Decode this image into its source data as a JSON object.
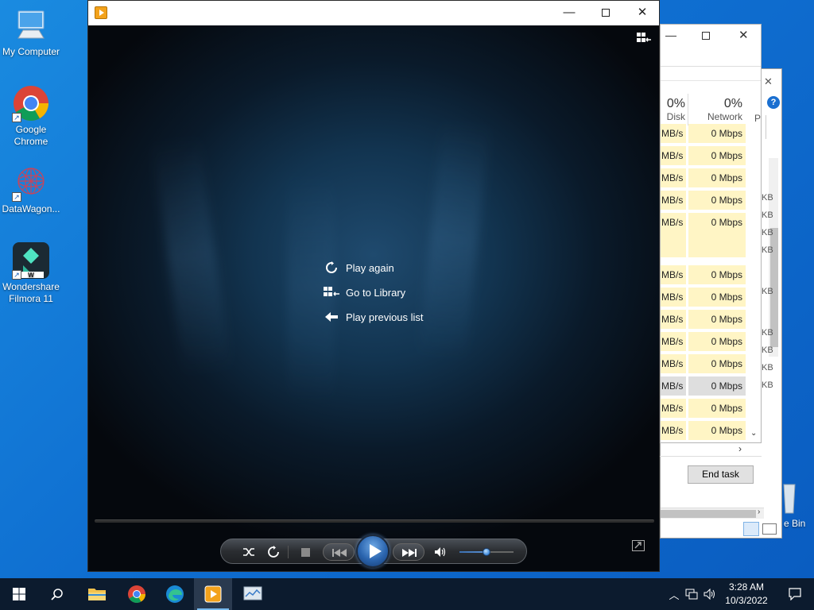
{
  "desktop": {
    "icons": [
      {
        "label": "My Computer"
      },
      {
        "label": "Google Chrome"
      },
      {
        "label": "DataWagon..."
      },
      {
        "label": "Wondershare Filmora 11"
      }
    ],
    "recycle_bin_label_partial": "e Bin"
  },
  "media_player": {
    "title": "",
    "menu": [
      {
        "label": "Play again",
        "icon": "replay-icon"
      },
      {
        "label": "Go to Library",
        "icon": "library-icon"
      },
      {
        "label": "Play previous list",
        "icon": "back-arrow-icon"
      }
    ],
    "controls": [
      "shuffle",
      "repeat",
      "stop",
      "previous",
      "play",
      "next",
      "mute",
      "volume"
    ],
    "volume_fraction": 0.5
  },
  "task_manager": {
    "disk_header": {
      "pct": "0%",
      "label": "Disk"
    },
    "network_header": {
      "pct": "0%",
      "label": "Network"
    },
    "partial_col": "P",
    "rows": [
      {
        "disk": "MB/s",
        "net": "0 Mbps"
      },
      {
        "disk": "MB/s",
        "net": "0 Mbps"
      },
      {
        "disk": "MB/s",
        "net": "0 Mbps"
      },
      {
        "disk": "MB/s",
        "net": "0 Mbps"
      },
      {
        "disk": "MB/s",
        "net": "0 Mbps"
      },
      {
        "disk": "",
        "net": ""
      },
      {
        "disk": "MB/s",
        "net": "0 Mbps"
      },
      {
        "disk": "MB/s",
        "net": "0 Mbps"
      },
      {
        "disk": "MB/s",
        "net": "0 Mbps"
      },
      {
        "disk": "MB/s",
        "net": "0 Mbps"
      },
      {
        "disk": "MB/s",
        "net": "0 Mbps"
      },
      {
        "disk": "MB/s",
        "net": "0 Mbps"
      },
      {
        "disk": "MB/s",
        "net": "0 Mbps"
      },
      {
        "disk": "MB/s",
        "net": "0 Mbps"
      }
    ],
    "kb_labels": [
      "KB",
      "KB",
      "KB",
      "KB",
      "KB",
      "KB",
      "KB",
      "KB",
      "KB"
    ],
    "end_task_label": "End task"
  },
  "taskbar": {
    "time": "3:28 AM",
    "date": "10/3/2022"
  }
}
